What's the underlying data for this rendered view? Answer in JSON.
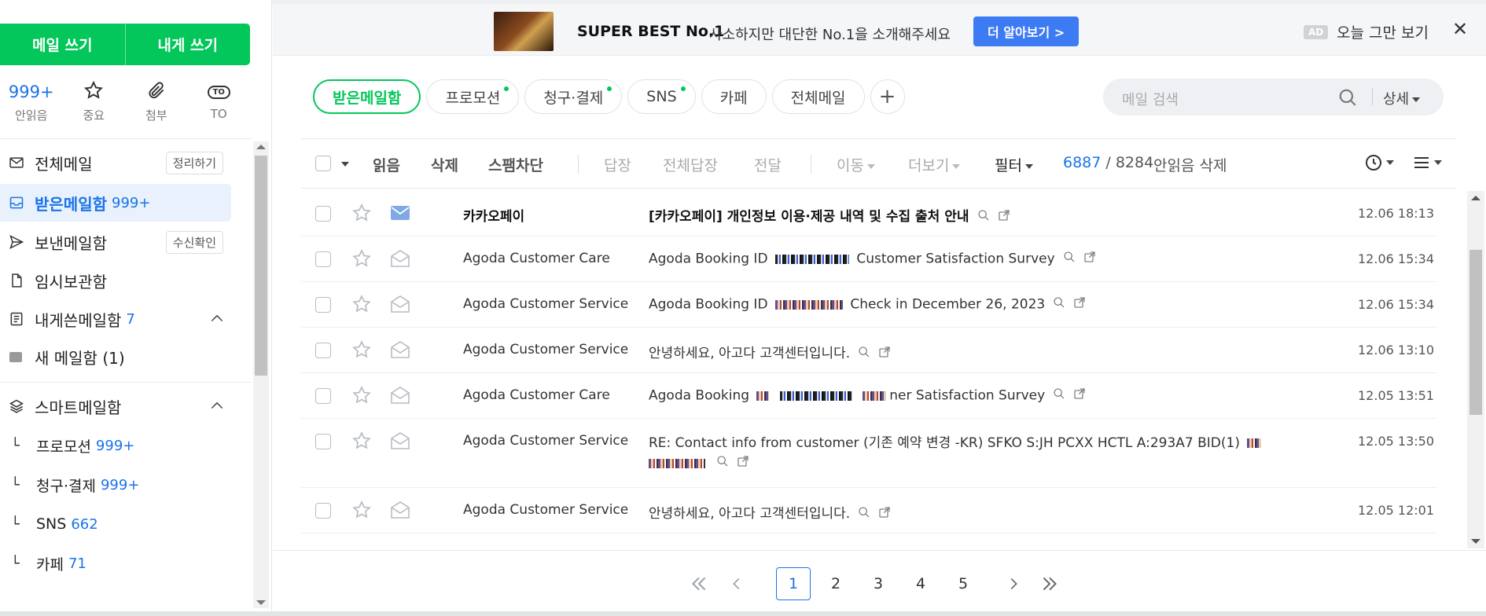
{
  "compose": {
    "write_mail": "메일 쓰기",
    "write_to_me": "내게 쓰기"
  },
  "quick": {
    "unread_count": "999+",
    "unread_label": "안읽음",
    "important_label": "중요",
    "attach_label": "첨부",
    "to_icon_text": "TO",
    "to_label": "TO"
  },
  "folders": {
    "all": {
      "label": "전체메일",
      "action": "정리하기"
    },
    "inbox": {
      "label": "받은메일함",
      "count": "999+"
    },
    "sent": {
      "label": "보낸메일함",
      "action": "수신확인"
    },
    "drafts": {
      "label": "임시보관함"
    },
    "to_me": {
      "label": "내게쓴메일함",
      "count": "7"
    },
    "new_box": {
      "label": "새 메일함 (1)"
    },
    "smart": {
      "label": "스마트메일함"
    },
    "promo": {
      "label": "프로모션",
      "count": "999+"
    },
    "billing": {
      "label": "청구·결제",
      "count": "999+"
    },
    "sns": {
      "label": "SNS",
      "count": "662"
    },
    "cafe": {
      "label": "카페",
      "count": "71"
    }
  },
  "ad": {
    "title": "SUPER BEST No.1",
    "text": "사소하지만 대단한 No.1을 소개해주세요",
    "button": "더 알아보기 >",
    "tag": "AD",
    "hide": "오늘 그만 보기",
    "close": "✕"
  },
  "tabs": [
    {
      "label": "받은메일함"
    },
    {
      "label": "프로모션"
    },
    {
      "label": "청구·결제"
    },
    {
      "label": "SNS"
    },
    {
      "label": "카페"
    },
    {
      "label": "전체메일"
    },
    {
      "label": "+"
    }
  ],
  "search": {
    "placeholder": "메일 검색",
    "detail": "상세"
  },
  "toolbar": {
    "read": "읽음",
    "delete": "삭제",
    "spam": "스팸차단",
    "reply": "답장",
    "reply_all": "전체답장",
    "forward": "전달",
    "move": "이동",
    "more": "더보기",
    "filter": "필터",
    "unread_count": "6887",
    "total_sep": " / 8284",
    "delete_unread": "안읽음 삭제"
  },
  "mails": [
    {
      "sender": "카카오페이",
      "subject": "[카카오페이] 개인정보 이용·제공 내역 및 수집 출처 안내",
      "date": "12.06 18:13",
      "unread": true
    },
    {
      "sender": "Agoda Customer Care",
      "subject_a": "Agoda Booking ID",
      "subject_b": "Customer Satisfaction Survey",
      "date": "12.06 15:34"
    },
    {
      "sender": "Agoda Customer Service",
      "subject_a": "Agoda Booking ID",
      "subject_b": "Check in December 26, 2023",
      "date": "12.06 15:34"
    },
    {
      "sender": "Agoda Customer Service",
      "subject": "안녕하세요, 아고다 고객센터입니다.",
      "date": "12.06 13:10"
    },
    {
      "sender": "Agoda Customer Care",
      "subject_a": "Agoda Booking",
      "subject_b": "ner Satisfaction Survey",
      "date": "12.05 13:51"
    },
    {
      "sender": "Agoda Customer Service",
      "subject": "RE: Contact info from customer (기존 예약 변경 -KR) SFKO S:JH PCXX HCTL A:293A7 BID(1)",
      "date": "12.05 13:50"
    },
    {
      "sender": "Agoda Customer Service",
      "subject": "안녕하세요, 아고다 고객센터입니다.",
      "date": "12.05 12:01"
    }
  ],
  "pager": {
    "pages": [
      "1",
      "2",
      "3",
      "4",
      "5"
    ]
  }
}
